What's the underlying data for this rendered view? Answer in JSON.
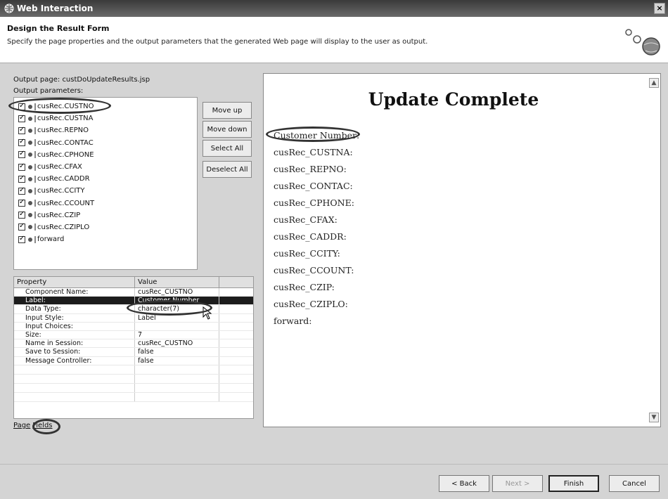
{
  "window": {
    "title": "Web Interaction",
    "close_label": "×"
  },
  "header": {
    "title": "Design the Result Form",
    "description": "Specify the page properties and the output parameters that the generated Web page will display to the user as output."
  },
  "left": {
    "output_page": "Output page: custDoUpdateResults.jsp",
    "params_label": "Output parameters:",
    "params": [
      "cusRec.CUSTNO",
      "cusRec.CUSTNA",
      "cusRec.REPNO",
      "cusRec.CONTAC",
      "cusRec.CPHONE",
      "cusRec.CFAX",
      "cusRec.CADDR",
      "cusRec.CCITY",
      "cusRec.CCOUNT",
      "cusRec.CZIP",
      "cusRec.CZIPLO",
      "forward"
    ],
    "buttons": {
      "move_up": "Move up",
      "move_down": "Move down",
      "select_all": "Select All",
      "deselect_all": "Deselect All"
    }
  },
  "properties": {
    "headers": {
      "property": "Property",
      "value": "Value"
    },
    "rows": [
      {
        "property": "Component Name:",
        "value": "cusRec_CUSTNO"
      },
      {
        "property": "Label:",
        "value": "Customer Number"
      },
      {
        "property": "Data Type:",
        "value": "character(7)"
      },
      {
        "property": "Input Style:",
        "value": "Label"
      },
      {
        "property": "Input Choices:",
        "value": ""
      },
      {
        "property": "Size:",
        "value": "7"
      },
      {
        "property": "Name in Session:",
        "value": "cusRec_CUSTNO"
      },
      {
        "property": "Save to Session:",
        "value": "false"
      },
      {
        "property": "Message Controller:",
        "value": "false"
      }
    ]
  },
  "tabs": {
    "page": "Page",
    "fields": "Fields"
  },
  "preview": {
    "heading": "Update Complete",
    "fields": [
      "Customer Number:",
      "cusRec_CUSTNA:",
      "cusRec_REPNO:",
      "cusRec_CONTAC:",
      "cusRec_CPHONE:",
      "cusRec_CFAX:",
      "cusRec_CADDR:",
      "cusRec_CCITY:",
      "cusRec_CCOUNT:",
      "cusRec_CZIP:",
      "cusRec_CZIPLO:",
      "forward:"
    ]
  },
  "footer": {
    "back": "< Back",
    "next": "Next >",
    "finish": "Finish",
    "cancel": "Cancel"
  }
}
